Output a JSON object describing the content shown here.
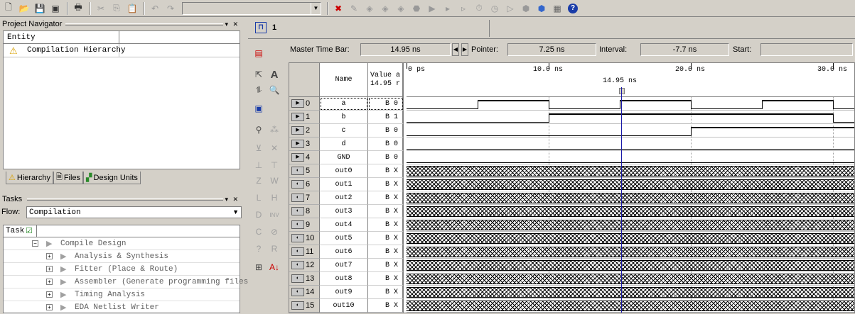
{
  "toolbar": {
    "icons": [
      "new-file-icon",
      "open-folder-icon",
      "save-icon",
      "save-all-icon",
      "print-icon",
      "cut-icon",
      "copy-icon",
      "paste-icon",
      "undo-icon",
      "redo-icon"
    ],
    "icons_right": [
      "compile-x-icon",
      "pencil-icon",
      "analyze-icon",
      "fitter-icon",
      "stop-icon",
      "start-icon",
      "run-step-icon",
      "run-analysis-icon",
      "timing-icon",
      "clock-icon",
      "simulate-icon",
      "netlist-icon",
      "programmer-icon",
      "chip-icon",
      "help-icon"
    ],
    "combo_value": ""
  },
  "project_navigator": {
    "title": "Project Navigator",
    "column_entity": "Entity",
    "item": "Compilation Hierarchy",
    "tabs": [
      "Hierarchy",
      "Files",
      "Design Units"
    ]
  },
  "tasks": {
    "title": "Tasks",
    "flow_label": "Flow:",
    "flow_value": "Compilation",
    "column_task": "Task",
    "items": [
      {
        "label": "Compile Design",
        "indent": 0
      },
      {
        "label": "Analysis & Synthesis",
        "indent": 1
      },
      {
        "label": "Fitter (Place & Route)",
        "indent": 1
      },
      {
        "label": "Assembler (Generate programming files)",
        "indent": 1
      },
      {
        "label": "Timing Analysis",
        "indent": 1
      },
      {
        "label": "EDA Netlist Writer",
        "indent": 1
      }
    ]
  },
  "waveform": {
    "tab_label": "1",
    "master_time_bar_label": "Master Time Bar:",
    "master_time_bar_value": "14.95 ns",
    "pointer_label": "Pointer:",
    "pointer_value": "7.25 ns",
    "interval_label": "Interval:",
    "interval_value": "-7.7 ns",
    "start_label": "Start:",
    "start_value": "",
    "col_name": "Name",
    "col_value": "Value a",
    "col_value_sub": "14.95 r",
    "time_labels": [
      "0 ps",
      "10.0 ns",
      "20.0 ns",
      "30.0 ns"
    ],
    "cursor_label": "14.95 ns",
    "signals": [
      {
        "index": "0",
        "name": "a",
        "value": "B 0",
        "kind": "input",
        "pattern": [
          0,
          1,
          0,
          1,
          0,
          1,
          0
        ],
        "selected": true
      },
      {
        "index": "1",
        "name": "b",
        "value": "B 1",
        "kind": "input",
        "pattern": [
          0,
          1,
          1,
          0
        ]
      },
      {
        "index": "2",
        "name": "c",
        "value": "B 0",
        "kind": "input",
        "pattern": [
          0,
          1
        ]
      },
      {
        "index": "3",
        "name": "d",
        "value": "B 0",
        "kind": "input",
        "pattern": [
          0
        ]
      },
      {
        "index": "4",
        "name": "GND",
        "value": "B 0",
        "kind": "input",
        "pattern": [
          0
        ]
      },
      {
        "index": "5",
        "name": "out0",
        "value": "B X",
        "kind": "output"
      },
      {
        "index": "6",
        "name": "out1",
        "value": "B X",
        "kind": "output"
      },
      {
        "index": "7",
        "name": "out2",
        "value": "B X",
        "kind": "output"
      },
      {
        "index": "8",
        "name": "out3",
        "value": "B X",
        "kind": "output"
      },
      {
        "index": "9",
        "name": "out4",
        "value": "B X",
        "kind": "output"
      },
      {
        "index": "10",
        "name": "out5",
        "value": "B X",
        "kind": "output"
      },
      {
        "index": "11",
        "name": "out6",
        "value": "B X",
        "kind": "output"
      },
      {
        "index": "12",
        "name": "out7",
        "value": "B X",
        "kind": "output"
      },
      {
        "index": "13",
        "name": "out8",
        "value": "B X",
        "kind": "output"
      },
      {
        "index": "14",
        "name": "out9",
        "value": "B X",
        "kind": "output"
      },
      {
        "index": "15",
        "name": "out10",
        "value": "B X",
        "kind": "output"
      }
    ]
  }
}
